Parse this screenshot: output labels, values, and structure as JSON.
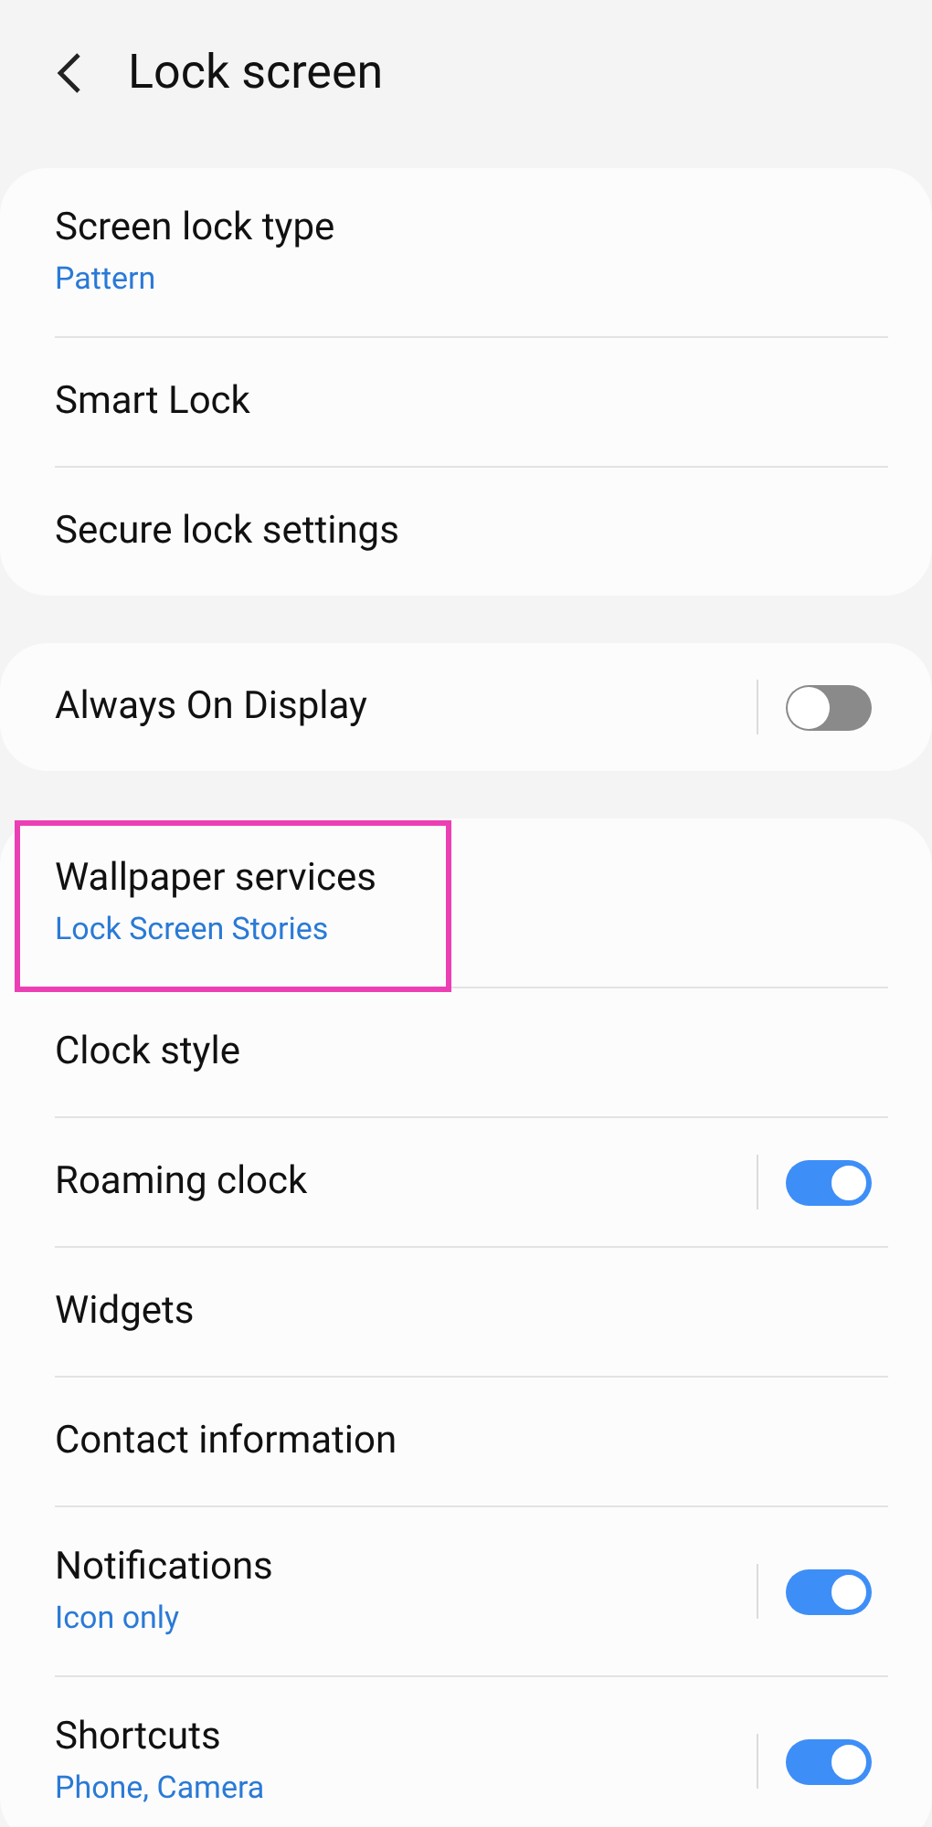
{
  "header": {
    "title": "Lock screen"
  },
  "groups": [
    {
      "items": [
        {
          "kind": "link",
          "title": "Screen lock type",
          "subtitle": "Pattern",
          "highlighted": false
        },
        {
          "kind": "link",
          "title": "Smart Lock",
          "highlighted": false
        },
        {
          "kind": "link",
          "title": "Secure lock settings",
          "highlighted": false
        }
      ]
    },
    {
      "items": [
        {
          "kind": "switch",
          "title": "Always On Display",
          "on": false,
          "highlighted": false
        }
      ]
    },
    {
      "items": [
        {
          "kind": "link",
          "title": "Wallpaper services",
          "subtitle": "Lock Screen Stories",
          "highlighted": true
        },
        {
          "kind": "link",
          "title": "Clock style",
          "highlighted": false
        },
        {
          "kind": "switch",
          "title": "Roaming clock",
          "on": true,
          "highlighted": false
        },
        {
          "kind": "link",
          "title": "Widgets",
          "highlighted": false
        },
        {
          "kind": "link",
          "title": "Contact information",
          "highlighted": false
        },
        {
          "kind": "switch",
          "title": "Notifications",
          "subtitle": "Icon only",
          "on": true,
          "highlighted": false
        },
        {
          "kind": "switch",
          "title": "Shortcuts",
          "subtitle": "Phone, Camera",
          "on": true,
          "highlighted": false
        }
      ]
    }
  ]
}
